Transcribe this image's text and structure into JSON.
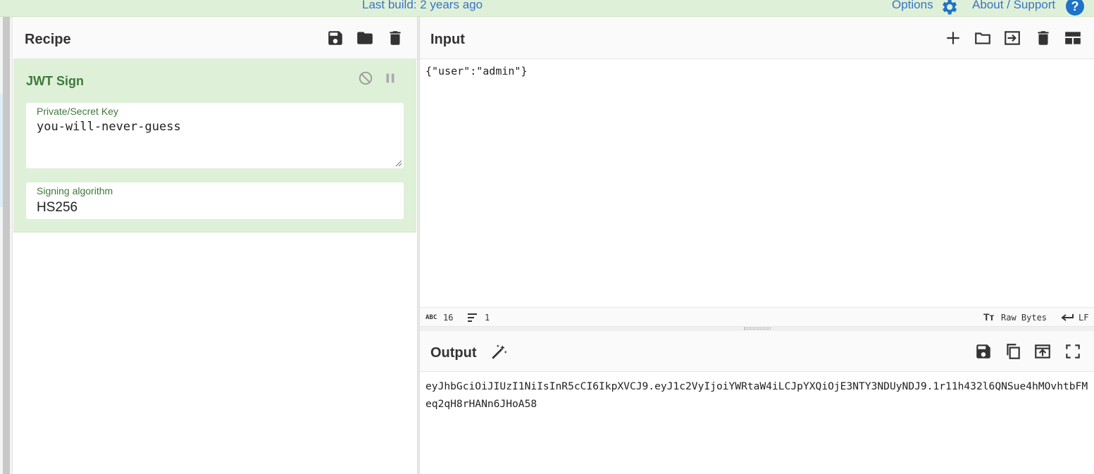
{
  "banner": {
    "build_text": "Last build: 2 years ago",
    "options_label": "Options",
    "about_label": "About / Support",
    "help_glyph": "?"
  },
  "recipe": {
    "title": "Recipe",
    "operation": {
      "name": "JWT Sign",
      "fields": {
        "key_label": "Private/Secret Key",
        "key_value": "you-will-never-guess",
        "algorithm_label": "Signing algorithm",
        "algorithm_value": "HS256"
      }
    },
    "icons": [
      "save-icon",
      "folder-icon",
      "trash-icon"
    ]
  },
  "input": {
    "title": "Input",
    "text": "{\"user\":\"admin\"}",
    "icons": [
      "plus-icon",
      "folder-icon",
      "import-icon",
      "trash-icon",
      "layout-icon"
    ],
    "status": {
      "chars_icon": "ABC",
      "chars": "16",
      "lines": "1",
      "encoding": "Raw Bytes",
      "eol": "LF"
    }
  },
  "output": {
    "title": "Output",
    "text": "eyJhbGciOiJIUzI1NiIsInR5cCI6IkpXVCJ9.eyJ1c2VyIjoiYWRtaW4iLCJpYXQiOjE3NTY3NDUyNDJ9.1r11h432l6QNSue4hMOvhtbFMeq2qH8rHANn6JHoA58",
    "icons": [
      "magic-wand-icon",
      "save-icon",
      "copy-icon",
      "send-to-input-icon",
      "fullscreen-icon"
    ]
  },
  "colors": {
    "accent_blue": "#3a73c4",
    "op_green_bg": "#dff0d8",
    "op_green_text": "#3c7a3a"
  }
}
